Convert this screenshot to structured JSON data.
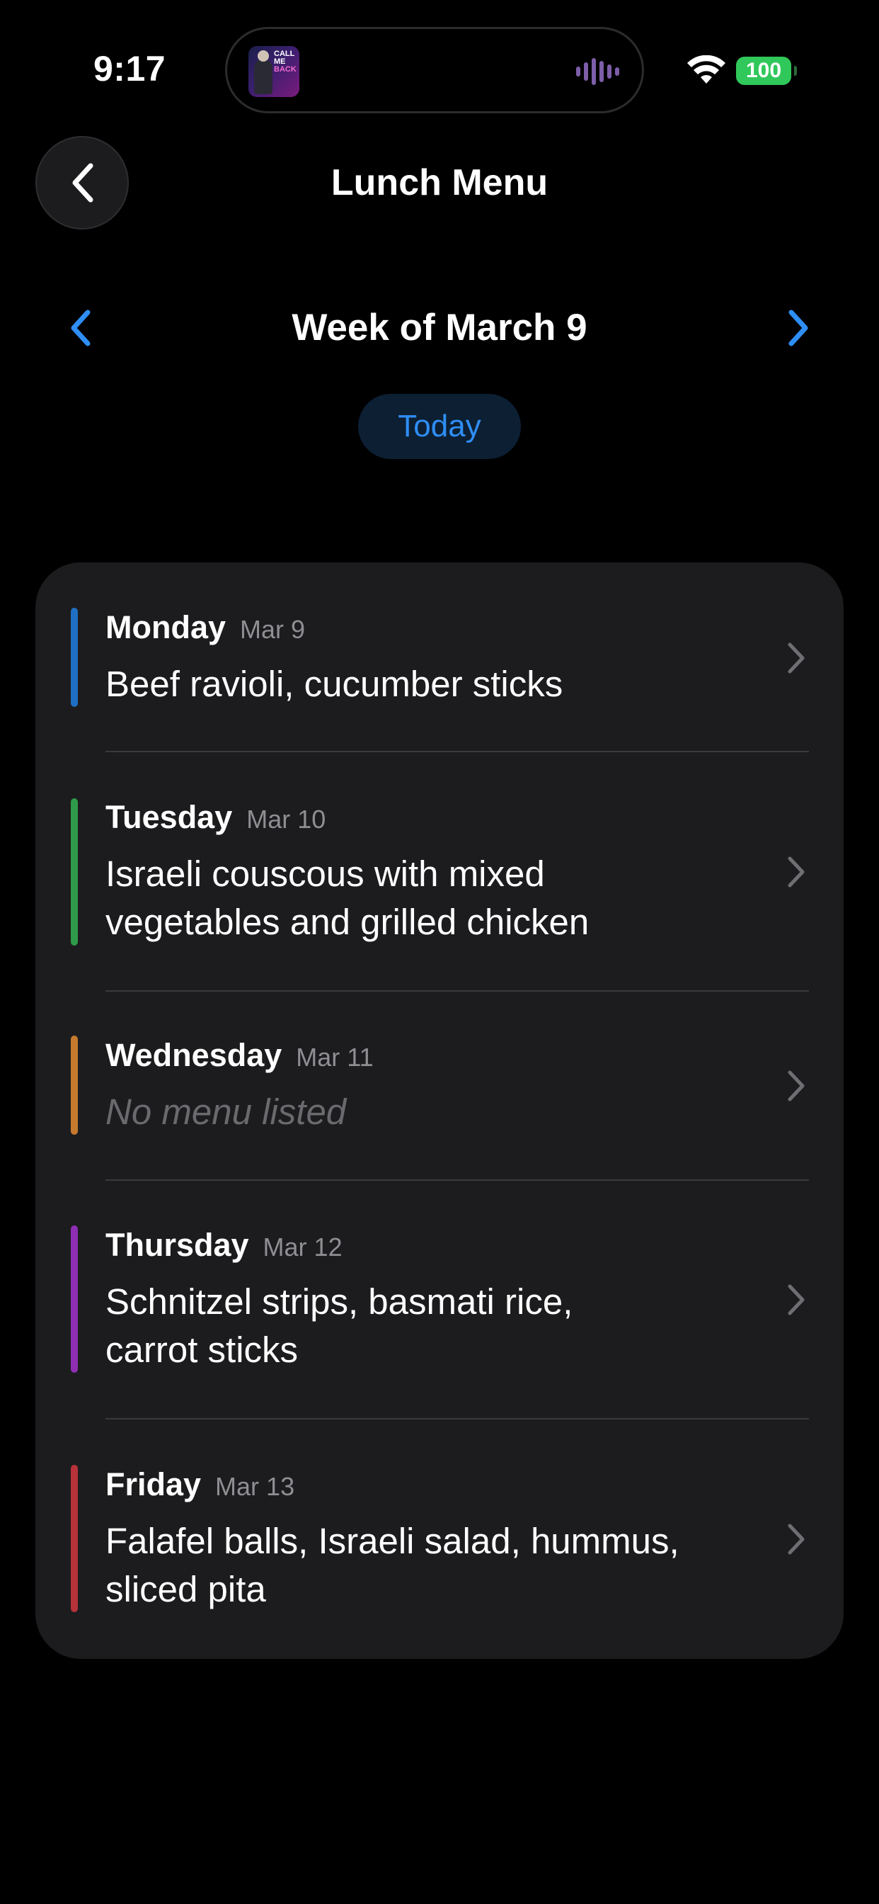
{
  "status_bar": {
    "time": "9:17",
    "battery": "100"
  },
  "island": {
    "art_text": [
      "CALL",
      "ME",
      "BACK"
    ]
  },
  "nav": {
    "title": "Lunch Menu"
  },
  "week": {
    "title": "Week of March 9",
    "today_label": "Today"
  },
  "days": [
    {
      "name": "Monday",
      "date": "Mar 9",
      "menu": "Beef ravioli, cucumber sticks",
      "color": "#1f6fc4"
    },
    {
      "name": "Tuesday",
      "date": "Mar 10",
      "menu": "Israeli couscous with mixed vegetables and grilled chicken",
      "color": "#2f9a4a"
    },
    {
      "name": "Wednesday",
      "date": "Mar 11",
      "menu": "No menu listed",
      "color": "#c67a2e"
    },
    {
      "name": "Thursday",
      "date": "Mar 12",
      "menu": "Schnitzel strips, basmati rice, carrot sticks",
      "color": "#8e2fb3"
    },
    {
      "name": "Friday",
      "date": "Mar 13",
      "menu": "Falafel balls, Israeli salad, hummus, sliced pita",
      "color": "#b8323a"
    }
  ],
  "colors": {
    "accent": "#2f8ef5",
    "battery": "#30c85a",
    "card": "#1c1c1e"
  }
}
